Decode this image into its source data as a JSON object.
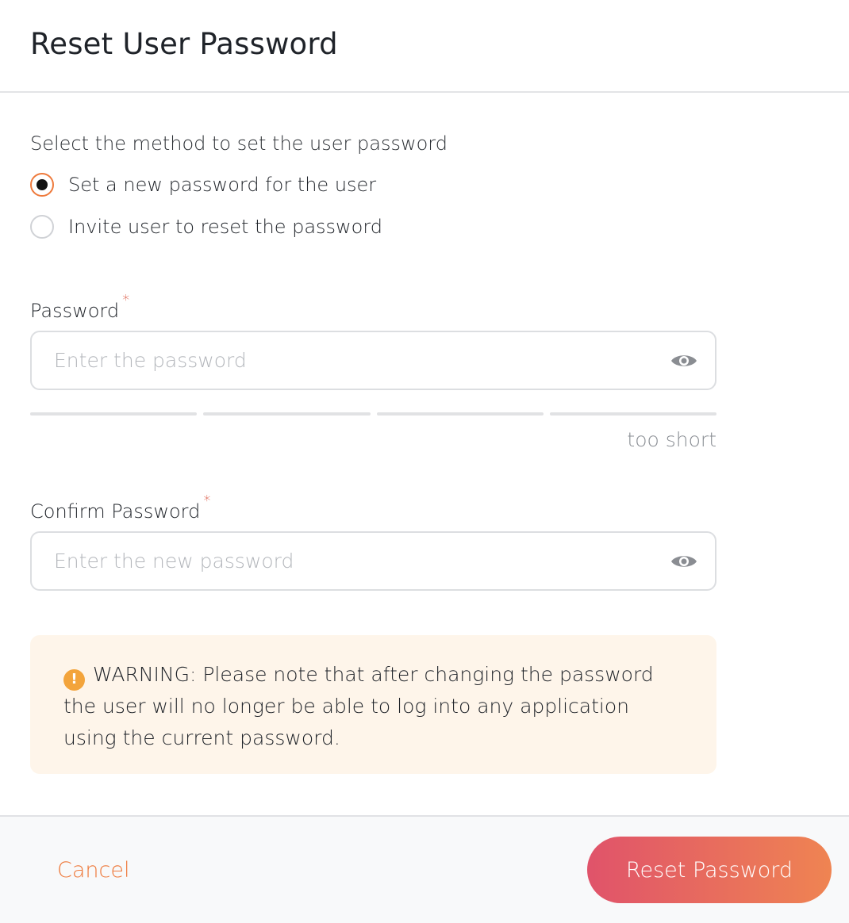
{
  "dialog": {
    "title": "Reset User Password"
  },
  "method": {
    "label": "Select the method to set the user password",
    "options": [
      {
        "label": "Set a new password for the user",
        "selected": true
      },
      {
        "label": "Invite user to reset the password",
        "selected": false
      }
    ]
  },
  "password": {
    "label": "Password",
    "required_mark": "*",
    "value": "",
    "placeholder": "Enter the password",
    "toggle_icon": "eye-icon",
    "strength_segments_filled": 0,
    "strength_text": "too short"
  },
  "confirm_password": {
    "label": "Confirm Password",
    "required_mark": "*",
    "value": "",
    "placeholder": "Enter the new password",
    "toggle_icon": "eye-icon"
  },
  "warning": {
    "icon": "exclamation-circle-icon",
    "text": "WARNING: Please note that after changing the password the user will no longer be able to log into any application using the current password."
  },
  "footer": {
    "cancel_label": "Cancel",
    "submit_label": "Reset Password"
  },
  "colors": {
    "accent": "#ee7a3c",
    "button_gradient_start": "#e0536a",
    "button_gradient_end": "#ef8452",
    "required": "#d9503b",
    "warning_bg": "#fef5ea",
    "warning_icon": "#f3a43b"
  }
}
